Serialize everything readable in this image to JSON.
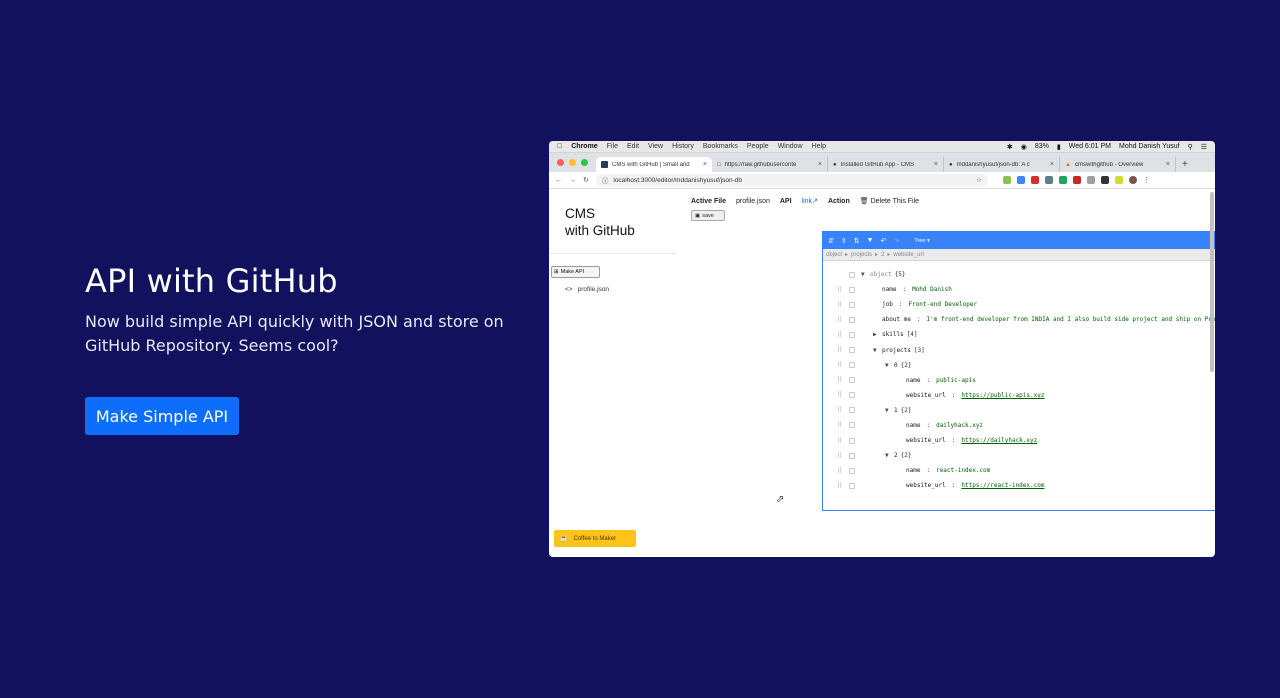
{
  "hero": {
    "title": "API with GitHub",
    "subtitle": "Now build simple API quickly with JSON and store on GitHub Repository. Seems cool?",
    "button": "Make Simple API"
  },
  "mac_menu": {
    "app": "Chrome",
    "items": [
      "File",
      "Edit",
      "View",
      "History",
      "Bookmarks",
      "People",
      "Window",
      "Help"
    ],
    "battery": "83%",
    "clock": "Wed 6:01 PM",
    "user": "Mohd Danish Yusuf"
  },
  "tabs": [
    {
      "title": "CMS with GitHub | Small and",
      "active": true
    },
    {
      "title": "https://raw.githubuserconte",
      "active": false
    },
    {
      "title": "Installed GitHub App - CMS",
      "active": false
    },
    {
      "title": "mddanishyusuf/json-db: A c",
      "active": false
    },
    {
      "title": "cmswithgithub - Overview",
      "active": false
    }
  ],
  "address": {
    "url": "localhost:3000/editor/mddanishyusuf/json-db"
  },
  "sidebar": {
    "brand_line1": "CMS",
    "brand_line2": "with GitHub",
    "make_api": "Make API",
    "file": "profile.json",
    "coffee": "Coffee to Maker"
  },
  "menu": {
    "active_file_label": "Active File",
    "active_file": "profile.json",
    "api": "API",
    "link": "link",
    "action": "Action",
    "delete": "Delete This File",
    "save": "save"
  },
  "editor": {
    "mode": "Tree",
    "nav": [
      "object",
      "projects",
      "2",
      "website_url"
    ],
    "rows": [
      {
        "indent": 0,
        "toggle": "▼",
        "key": "object",
        "count": "{5}",
        "root": true
      },
      {
        "indent": 1,
        "key": "name",
        "value": "Mohd Danish"
      },
      {
        "indent": 1,
        "key": "job",
        "value": "Front-end Developer"
      },
      {
        "indent": 1,
        "key": "about me",
        "value": "I'm front-end developer from INDIA and I also build side project and ship on ProductHunt."
      },
      {
        "indent": 1,
        "toggle": "▶",
        "key": "skills",
        "count": "[4]"
      },
      {
        "indent": 1,
        "toggle": "▼",
        "key": "projects",
        "count": "[3]"
      },
      {
        "indent": 2,
        "toggle": "▼",
        "key": "0",
        "count": "{2}"
      },
      {
        "indent": 3,
        "key": "name",
        "value": "public-apis"
      },
      {
        "indent": 3,
        "key": "website_url",
        "value": "https://public-apis.xyz",
        "url": true
      },
      {
        "indent": 2,
        "toggle": "▼",
        "key": "1",
        "count": "{2}"
      },
      {
        "indent": 3,
        "key": "name",
        "value": "dailyhack.xyz"
      },
      {
        "indent": 3,
        "key": "website_url",
        "value": "https://dailyhack.xyz",
        "url": true
      },
      {
        "indent": 2,
        "toggle": "▼",
        "key": "2",
        "count": "{2}"
      },
      {
        "indent": 3,
        "key": "name",
        "value": "react-index.com"
      },
      {
        "indent": 3,
        "key": "website_url",
        "value": "https://react-index.com",
        "url": true
      }
    ]
  },
  "colors": {
    "background": "#11115e",
    "primary": "#0d6efd",
    "editor_blue": "#3883fa",
    "coffee": "#ffc31a"
  }
}
